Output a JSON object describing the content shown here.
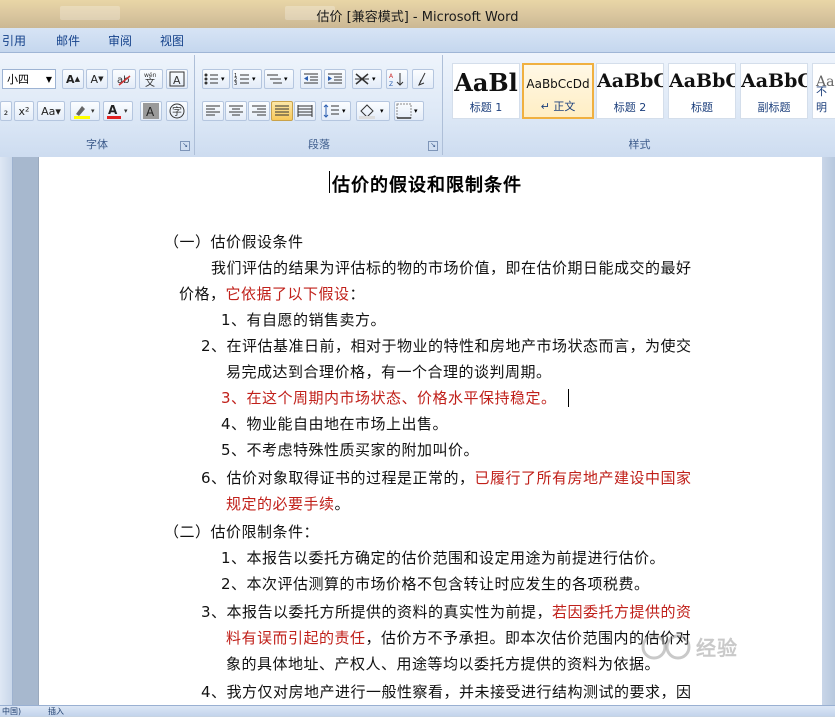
{
  "window": {
    "title": "估价 [兼容模式] - Microsoft Word"
  },
  "tabs": [
    "引用",
    "邮件",
    "审阅",
    "视图"
  ],
  "ribbon": {
    "font_size": "小四",
    "font_group_label": "字体",
    "paragraph_group_label": "段落",
    "styles_group_label": "样式",
    "styles": [
      {
        "sample": "AaBl",
        "name": "标题 1"
      },
      {
        "sample": "AaBbCcDd",
        "name": "↵ 正文",
        "selected": true
      },
      {
        "sample": "AaBbC",
        "name": "标题 2"
      },
      {
        "sample": "AaBbC",
        "name": "标题"
      },
      {
        "sample": "AaBbC",
        "name": "副标题"
      },
      {
        "sample": "AaB",
        "name": "不明"
      }
    ]
  },
  "document": {
    "title": "估价的假设和限制条件",
    "lines": [
      {
        "segments": [
          {
            "text": "（一）估价假设条件"
          }
        ]
      },
      {
        "segments": [
          {
            "text": "我们评估的结果为评估标的物的市场价值，即在估价期日能成交的最好"
          }
        ]
      },
      {
        "segments": [
          {
            "text": "价格，"
          },
          {
            "text": "它依据了以下假设",
            "red": true
          },
          {
            "text": "："
          }
        ]
      },
      {
        "segments": [
          {
            "text": "1、有自愿的销售卖方。"
          }
        ]
      },
      {
        "segments": [
          {
            "text": "2、在评估基准日前，相对于物业的特性和房地产市场状态而言，为使交"
          }
        ]
      },
      {
        "segments": [
          {
            "text": "易完成达到合理价格，有一个合理的谈判周期。"
          }
        ]
      },
      {
        "segments": [
          {
            "text": "3、在这个周期内市场状态、价格水平保持稳定。",
            "red": true
          }
        ]
      },
      {
        "segments": [
          {
            "text": "4、物业能自由地在市场上出售。"
          }
        ]
      },
      {
        "segments": [
          {
            "text": "5、不考虑特殊性质买家的附加叫价。"
          }
        ]
      },
      {
        "segments": [
          {
            "text": "6、估价对象取得证书的过程是正常的，"
          },
          {
            "text": "已履行了所有房地产建设中国家",
            "red": true
          }
        ]
      },
      {
        "segments": [
          {
            "text": "规定的必要手续",
            "red": true
          },
          {
            "text": "。"
          }
        ]
      },
      {
        "segments": [
          {
            "text": "（二）估价限制条件："
          }
        ]
      },
      {
        "segments": [
          {
            "text": "1、本报告以委托方确定的估价范围和设定用途为前提进行估价。"
          }
        ]
      },
      {
        "segments": [
          {
            "text": "2、本次评估测算的市场价格不包含转让时应发生的各项税费。"
          }
        ]
      },
      {
        "segments": [
          {
            "text": "3、本报告以委托方所提供的资料的真实性为前提，"
          },
          {
            "text": "若因委托方提供的资",
            "red": true
          }
        ]
      },
      {
        "segments": [
          {
            "text": "料有误而引起的责任",
            "red": true
          },
          {
            "text": "，估价方不予承担。即本次估价范围内的估价对"
          }
        ]
      },
      {
        "segments": [
          {
            "text": "象的具体地址、产权人、用途等均以委托方提供的资料为依据。"
          }
        ]
      },
      {
        "segments": [
          {
            "text": "4、我方仅对房地产进行一般性察看，并未接受进行结构测试的要求，因"
          }
        ]
      }
    ]
  },
  "statusbar": {
    "language": "中国)",
    "mode": "插入"
  },
  "colors": {
    "red_text": "#c0201a",
    "ribbon_accent": "#15428b",
    "selected_style": "#f0b040"
  }
}
